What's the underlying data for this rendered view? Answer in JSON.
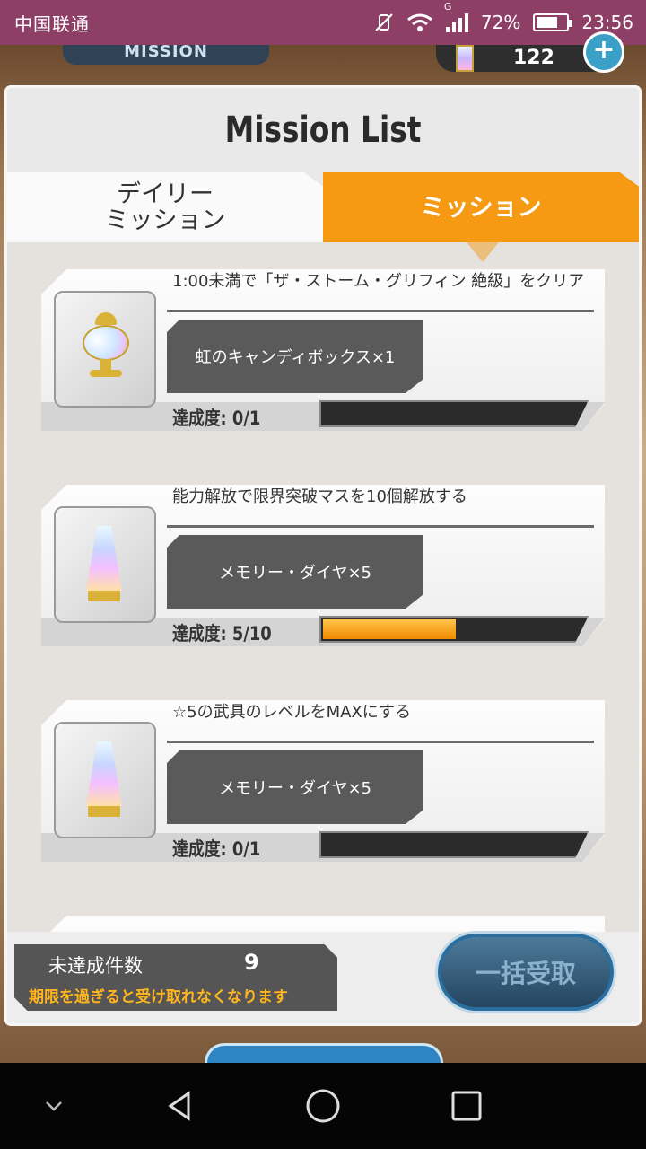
{
  "status_bar": {
    "carrier": "中国联通",
    "network": "G",
    "battery_percent": "72%",
    "battery_level": 0.72,
    "time": "23:56"
  },
  "top_hud": {
    "section_label": "MISSION",
    "currency_count": "122",
    "add_label": "+"
  },
  "panel": {
    "title": "Mission List",
    "tabs": [
      {
        "label": "デイリー\nミッション",
        "active": false
      },
      {
        "label": "ミッション",
        "active": true
      }
    ]
  },
  "missions": [
    {
      "title": "1:00未満で「ザ・ストーム・グリフィン 絶級」をクリア",
      "reward": "虹のキャンディボックス×1",
      "icon": "candy-box-icon",
      "progress_label": "達成度: 0/1",
      "progress": 0.0
    },
    {
      "title": "能力解放で限界突破マスを10個解放する",
      "reward": "メモリー・ダイヤ×5",
      "icon": "memory-diamond-icon",
      "progress_label": "達成度: 5/10",
      "progress": 0.5
    },
    {
      "title": "☆5の武具のレベルをMAXにする",
      "reward": "メモリー・ダイヤ×5",
      "icon": "memory-diamond-icon",
      "progress_label": "達成度: 0/1",
      "progress": 0.0
    }
  ],
  "footer": {
    "uncompleted_label": "未達成件数",
    "uncompleted_count": "9",
    "note": "期限を過ぎると受け取れなくなります",
    "claim_all_label": "一括受取"
  },
  "colors": {
    "accent_orange": "#f59a12",
    "status_bar": "#8d3f66",
    "progress_fill": "#f08a00"
  }
}
